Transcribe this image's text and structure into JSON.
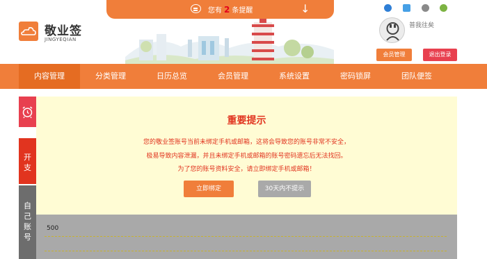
{
  "notice": {
    "prefix": "您有",
    "count": "2",
    "suffix": "条提醒"
  },
  "logo": {
    "title": "敬业签",
    "subtitle": "JINGYEQIAN"
  },
  "user": {
    "name": "普我往矣",
    "member_btn": "会员管理",
    "logout_btn": "退出登录"
  },
  "nav": {
    "items": [
      "内容管理",
      "分类管理",
      "日历总览",
      "会员管理",
      "系统设置",
      "密码锁屏",
      "团队便签"
    ],
    "active": 0
  },
  "sidebar": {
    "kaizhi": [
      "开",
      "支"
    ],
    "zhanghao": [
      "自",
      "己",
      "账",
      "号"
    ]
  },
  "alert": {
    "title": "重要提示",
    "lines": [
      "您的敬业签账号当前未绑定手机或邮箱，这将会导致您的账号非常不安全，",
      "极易导致内容泄漏，并且未绑定手机或邮箱的账号密码遗忘后无法找回。",
      "为了您的账号资料安全，请立即绑定手机或邮箱！"
    ],
    "bind_btn": "立即绑定",
    "dismiss_btn": "30天内不提示"
  },
  "chart": {
    "y_label": "500"
  },
  "colors": {
    "accent": "#f07e3a",
    "danger": "#e8404f",
    "text_red": "#e1341f",
    "panel": "#fffcd4",
    "grey": "#a9a9a9"
  },
  "icons": [
    "chat-icon",
    "arrow-down-icon",
    "ie-icon",
    "windows-icon",
    "apple-icon",
    "android-icon",
    "alarm-clock-icon",
    "cloud-logo-icon"
  ]
}
